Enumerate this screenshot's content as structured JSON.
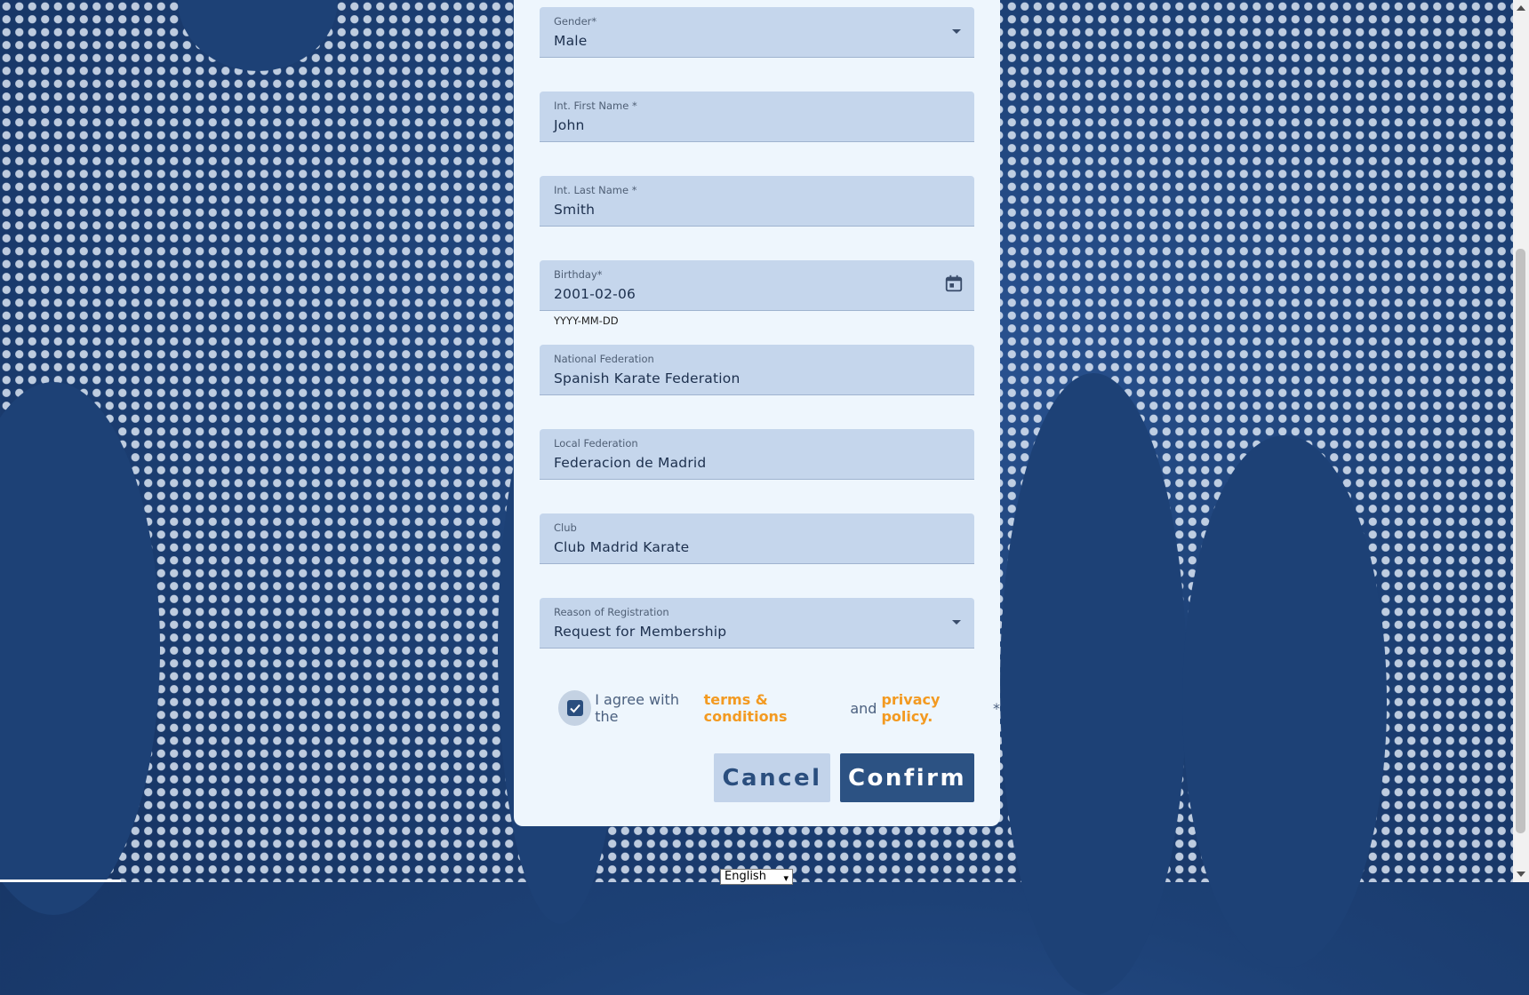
{
  "form": {
    "gender": {
      "label": "Gender*",
      "value": "Male"
    },
    "first_name": {
      "label": "Int. First Name *",
      "value": "John"
    },
    "last_name": {
      "label": "Int. Last Name *",
      "value": "Smith"
    },
    "birthday": {
      "label": "Birthday*",
      "value": "2001-02-06",
      "hint": "YYYY-MM-DD"
    },
    "national_federation": {
      "label": "National Federation",
      "value": "Spanish Karate Federation"
    },
    "local_federation": {
      "label": "Local Federation",
      "value": "Federacion de Madrid"
    },
    "club": {
      "label": "Club",
      "value": "Club Madrid Karate"
    },
    "reason": {
      "label": "Reason of Registration",
      "value": "Request for Membership"
    }
  },
  "agreement": {
    "prefix": "I agree with the",
    "terms_link": "terms & conditions",
    "middle": "and",
    "privacy_link": "privacy policy.",
    "required_mark": "*",
    "checked": true
  },
  "buttons": {
    "cancel": "Cancel",
    "confirm": "Confirm"
  },
  "footer": {
    "language": "English"
  },
  "colors": {
    "accent": "#f39a21",
    "primary": "#2c5283",
    "field_bg": "#c5d6ec",
    "card_bg": "#eef6fd"
  }
}
